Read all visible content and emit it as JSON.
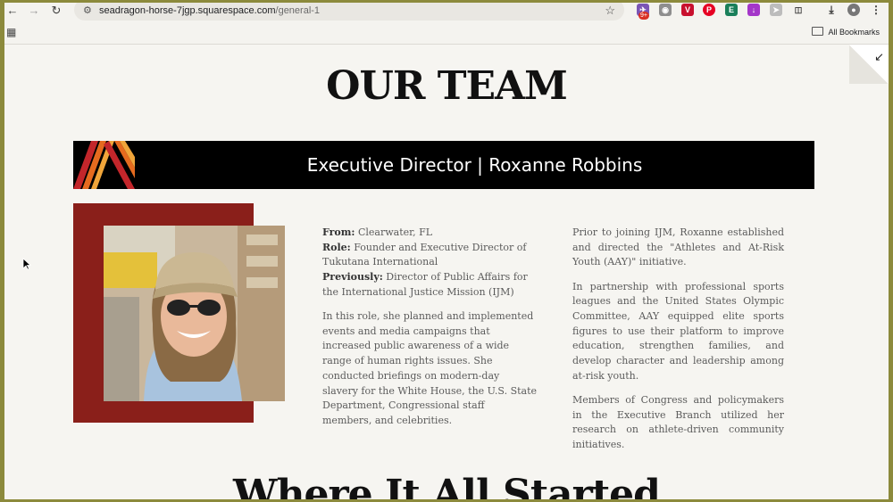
{
  "browser": {
    "url_host": "seadragon-horse-7jgp.squarespace.com",
    "url_path": "/general-1",
    "bookmarks_label": "All Bookmarks",
    "extension_badge": "9+"
  },
  "page": {
    "title": "OUR TEAM",
    "next_section_title": "Where It All Started"
  },
  "banner": {
    "text": "Executive Director | Roxanne Robbins",
    "pattern_colors": [
      "#c3262b",
      "#e56b1f",
      "#f0a53a"
    ]
  },
  "profile": {
    "from_label": "From:",
    "from_value": "Clearwater, FL",
    "role_label": "Role:",
    "role_value": "Founder and Executive Director of Tukutana International",
    "previously_label": "Previously:",
    "previously_value": "Director of Public Affairs for the International Justice Mission (IJM)",
    "paragraph_left": "In this role, she planned and implemented events and media campaigns that increased public awareness of a wide range of human rights issues. She conducted briefings on modern-day slavery for the White House, the U.S. State Department, Congressional staff members, and celebrities.",
    "paragraph_right_1": "Prior to joining IJM, Roxanne established and directed the \"Athletes and At-Risk Youth (AAY)\" initiative.",
    "paragraph_right_2": "In partnership with professional sports leagues and the United States Olympic Committee, AAY equipped elite sports figures to use their platform to improve education, strengthen families, and develop character and leadership among at-risk youth.",
    "paragraph_right_3": "Members of Congress and policymakers in the Executive Branch utilized her research on athlete-driven community initiatives."
  },
  "colors": {
    "accent_red": "#8a1f1a",
    "banner_bg": "#000000",
    "page_bg": "#f6f5f1"
  }
}
